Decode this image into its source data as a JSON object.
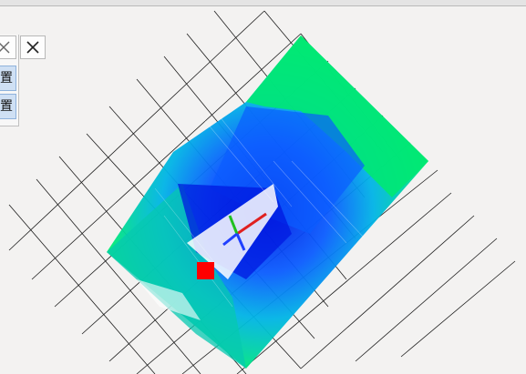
{
  "window": {
    "close_glyph": "✕"
  },
  "side_panel": {
    "buttons": [
      {
        "label": "置"
      },
      {
        "label": "置"
      }
    ]
  },
  "viewport": {
    "background": "#f3f2f1",
    "grid_color": "#1e1e1e",
    "point_cloud_colors": [
      "#00ff50",
      "#00d6a0",
      "#00b4e6",
      "#0a5cff",
      "#0018e0"
    ],
    "marker_color": "#ff0000",
    "axis_colors": {
      "x": "#e02020",
      "y": "#20c020",
      "z": "#2040ff"
    }
  }
}
